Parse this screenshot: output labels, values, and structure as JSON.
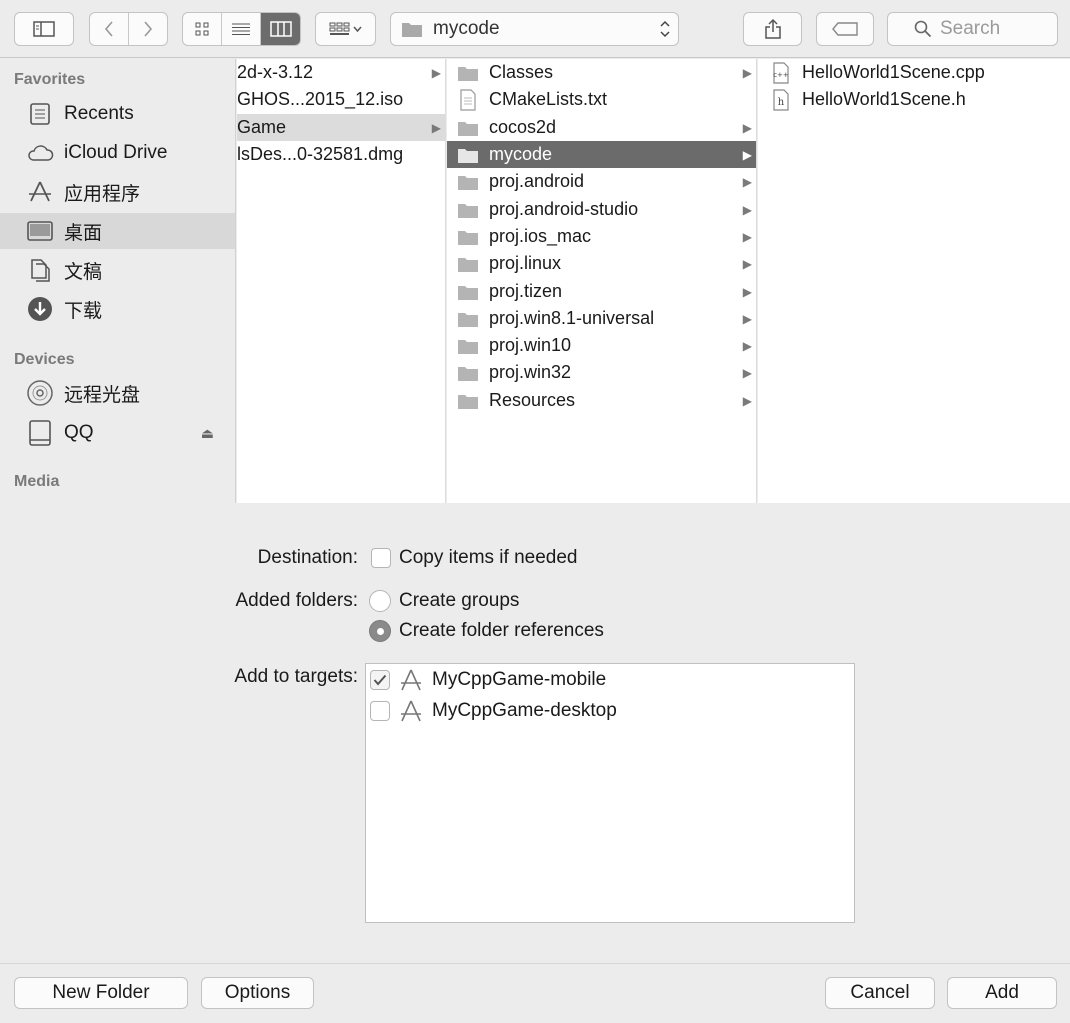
{
  "toolbar": {
    "path": "mycode",
    "search_placeholder": "Search"
  },
  "sidebar": {
    "favorites_header": "Favorites",
    "favorites": [
      {
        "label": "Recents",
        "icon": "recents-icon"
      },
      {
        "label": "iCloud Drive",
        "icon": "cloud-icon"
      },
      {
        "label": "应用程序",
        "icon": "applications-icon"
      },
      {
        "label": "桌面",
        "icon": "desktop-icon",
        "selected": true
      },
      {
        "label": "文稿",
        "icon": "documents-icon"
      },
      {
        "label": "下载",
        "icon": "downloads-icon"
      }
    ],
    "devices_header": "Devices",
    "devices": [
      {
        "label": "远程光盘",
        "icon": "disc-icon"
      },
      {
        "label": "QQ",
        "icon": "drive-icon",
        "eject": true
      }
    ],
    "media_header": "Media"
  },
  "column1": {
    "items": [
      {
        "label": "2d-x-3.12",
        "folder": true
      },
      {
        "label": "GHOS...2015_12.iso",
        "folder": false
      },
      {
        "label": "Game",
        "folder": true,
        "selected": true
      },
      {
        "label": "lsDes...0-32581.dmg",
        "folder": false
      }
    ]
  },
  "column2": {
    "items": [
      {
        "label": "Classes",
        "type": "folder"
      },
      {
        "label": "CMakeLists.txt",
        "type": "file"
      },
      {
        "label": "cocos2d",
        "type": "folder"
      },
      {
        "label": "mycode",
        "type": "folder",
        "selected": true
      },
      {
        "label": "proj.android",
        "type": "folder"
      },
      {
        "label": "proj.android-studio",
        "type": "folder"
      },
      {
        "label": "proj.ios_mac",
        "type": "folder"
      },
      {
        "label": "proj.linux",
        "type": "folder"
      },
      {
        "label": "proj.tizen",
        "type": "folder"
      },
      {
        "label": "proj.win8.1-universal",
        "type": "folder"
      },
      {
        "label": "proj.win10",
        "type": "folder"
      },
      {
        "label": "proj.win32",
        "type": "folder"
      },
      {
        "label": "Resources",
        "type": "folder"
      }
    ]
  },
  "column3": {
    "items": [
      {
        "label": "HelloWorld1Scene.cpp",
        "badge": "c++"
      },
      {
        "label": "HelloWorld1Scene.h",
        "badge": "h"
      }
    ]
  },
  "options": {
    "destination_label": "Destination:",
    "copy_items_label": "Copy items if needed",
    "copy_items_checked": false,
    "added_folders_label": "Added folders:",
    "create_groups_label": "Create groups",
    "create_refs_label": "Create folder references",
    "selected_folder_option": "Create folder references",
    "targets_label": "Add to targets:",
    "targets": [
      {
        "label": "MyCppGame-mobile",
        "checked": true
      },
      {
        "label": "MyCppGame-desktop",
        "checked": false
      }
    ]
  },
  "buttons": {
    "new_folder": "New Folder",
    "options": "Options",
    "cancel": "Cancel",
    "add": "Add"
  }
}
